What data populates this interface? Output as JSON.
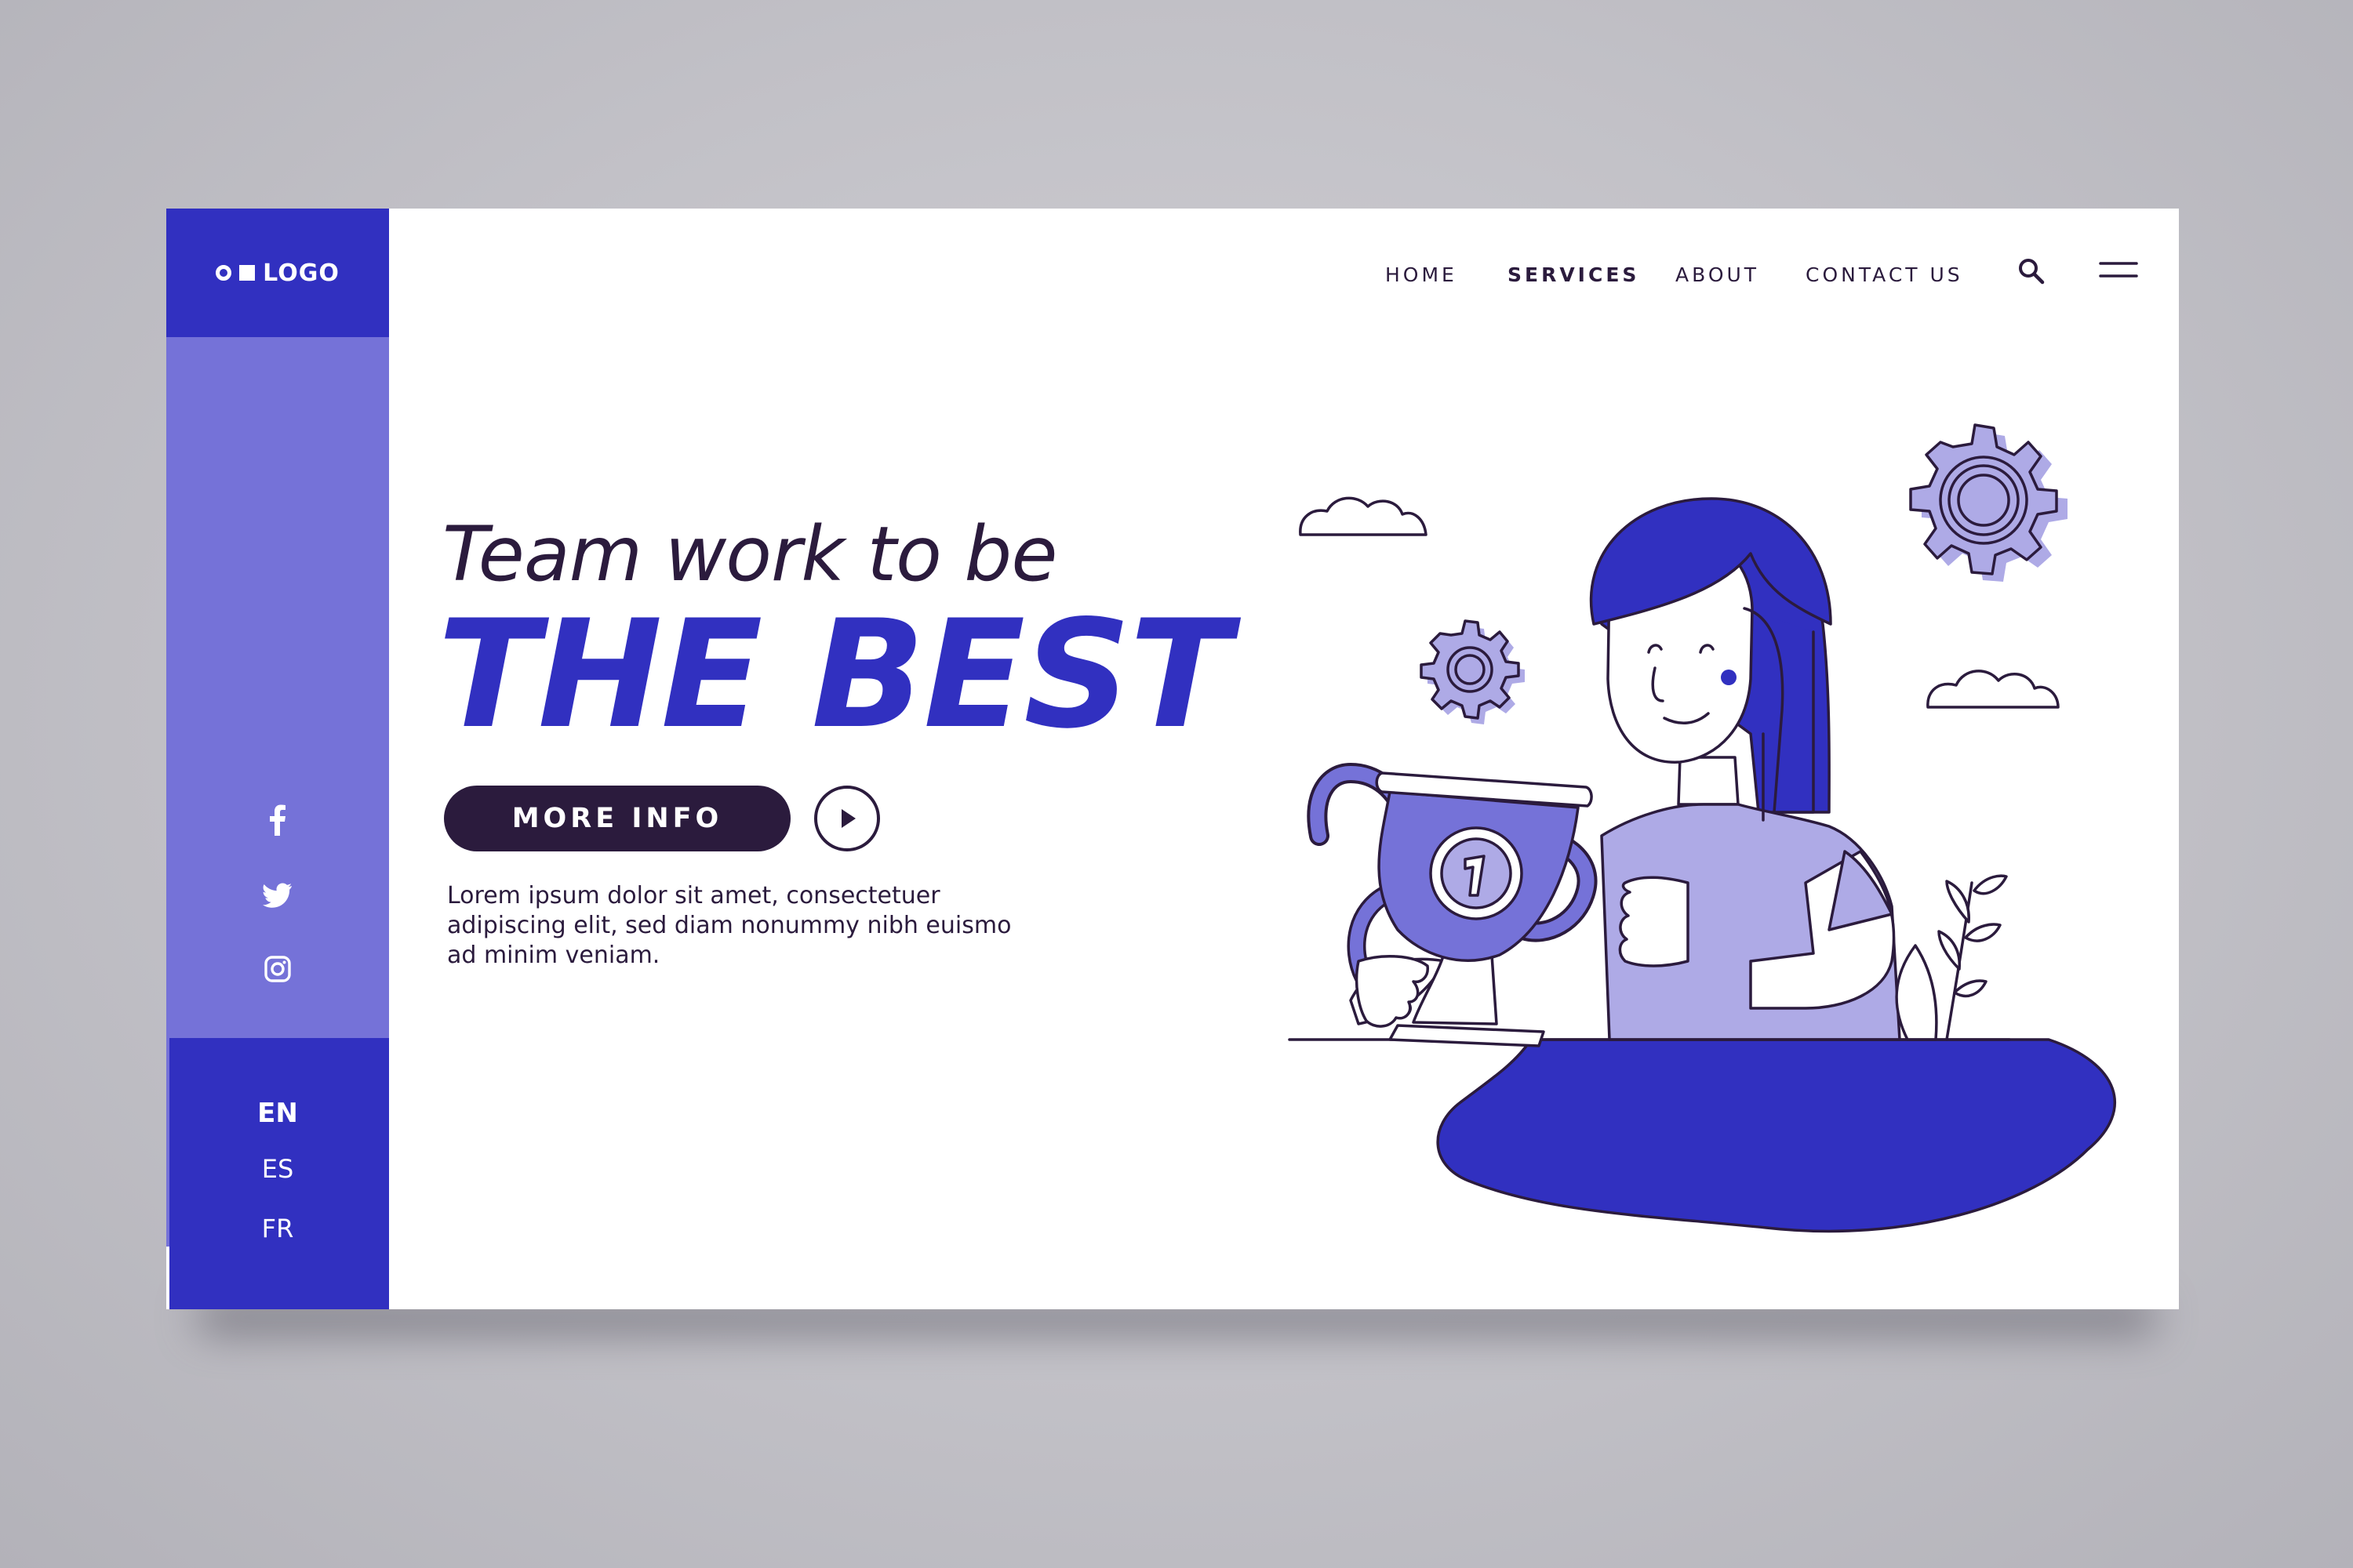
{
  "logo": {
    "text": "LOGO"
  },
  "nav": {
    "items": [
      {
        "label": "HOME",
        "active": false
      },
      {
        "label": "SERVICES",
        "active": true
      },
      {
        "label": "ABOUT",
        "active": false
      },
      {
        "label": "CONTACT US",
        "active": false
      }
    ],
    "search_icon": "search-icon",
    "menu_icon": "hamburger-menu-icon"
  },
  "hero": {
    "subtitle": "Team work to be",
    "title": "THE BEST",
    "button_label": "MORE INFO",
    "play_icon": "play-icon",
    "body": "Lorem ipsum dolor sit amet, consectetuer adipiscing elit, sed diam nonummy nibh euismo ad minim veniam."
  },
  "social": [
    "facebook-icon",
    "twitter-icon",
    "instagram-icon"
  ],
  "languages": [
    {
      "code": "EN",
      "active": true
    },
    {
      "code": "ES",
      "active": false
    },
    {
      "code": "FR",
      "active": false
    }
  ],
  "colors": {
    "primary": "#3130c0",
    "secondary": "#7572d8",
    "light": "#aeaae6",
    "dark": "#2b1b3d",
    "background": "#c8c7cd"
  }
}
